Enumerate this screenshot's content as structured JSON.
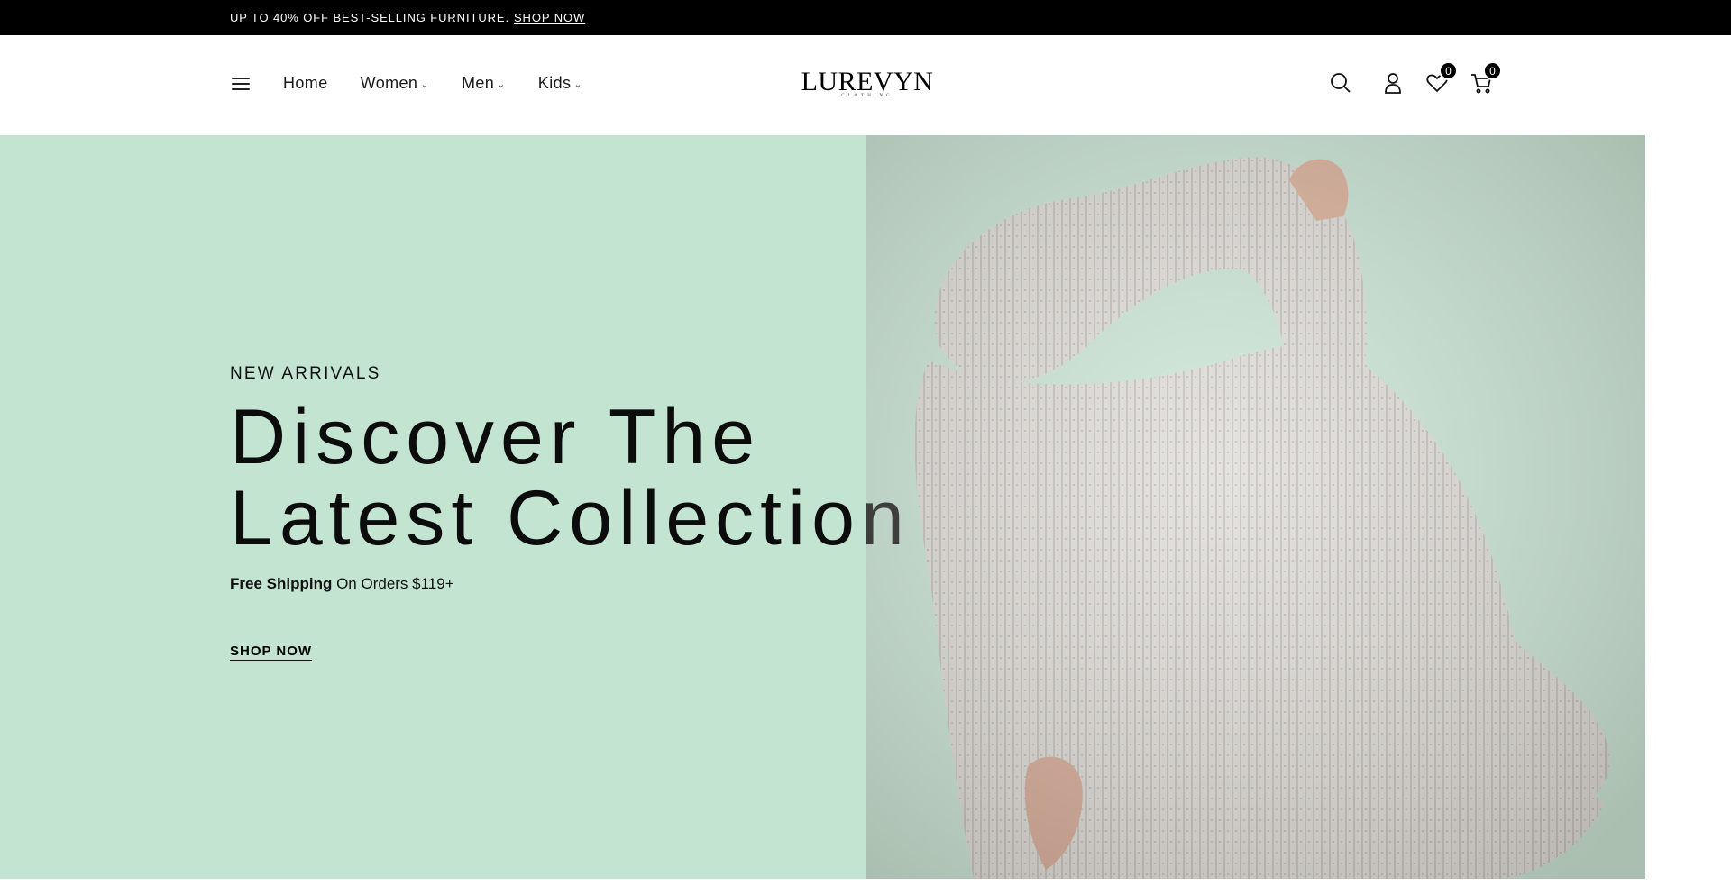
{
  "announcement": {
    "text": "UP TO 40% OFF BEST-SELLING FURNITURE.",
    "link_label": "SHOP NOW"
  },
  "header": {
    "logo_text": "LUREVYN",
    "logo_subtext": "CLOTHING",
    "nav": [
      {
        "label": "Home",
        "has_dropdown": false
      },
      {
        "label": "Women",
        "has_dropdown": true
      },
      {
        "label": "Men",
        "has_dropdown": true
      },
      {
        "label": "Kids",
        "has_dropdown": true
      }
    ],
    "icons": {
      "menu": "hamburger-icon",
      "search": "search-icon",
      "account": "user-icon",
      "wishlist": "heart-icon",
      "cart": "cart-icon"
    },
    "wishlist_count": "0",
    "cart_count": "0"
  },
  "hero": {
    "eyebrow": "NEW ARRIVALS",
    "headline_line1": "Discover The",
    "headline_line2": "Latest Collection",
    "shipping_bold": "Free Shipping",
    "shipping_rest": "On Orders $119+",
    "cta_label": "SHOP NOW",
    "background_color": "#c4e4d2",
    "slides_total": 3,
    "active_slide": 1
  }
}
